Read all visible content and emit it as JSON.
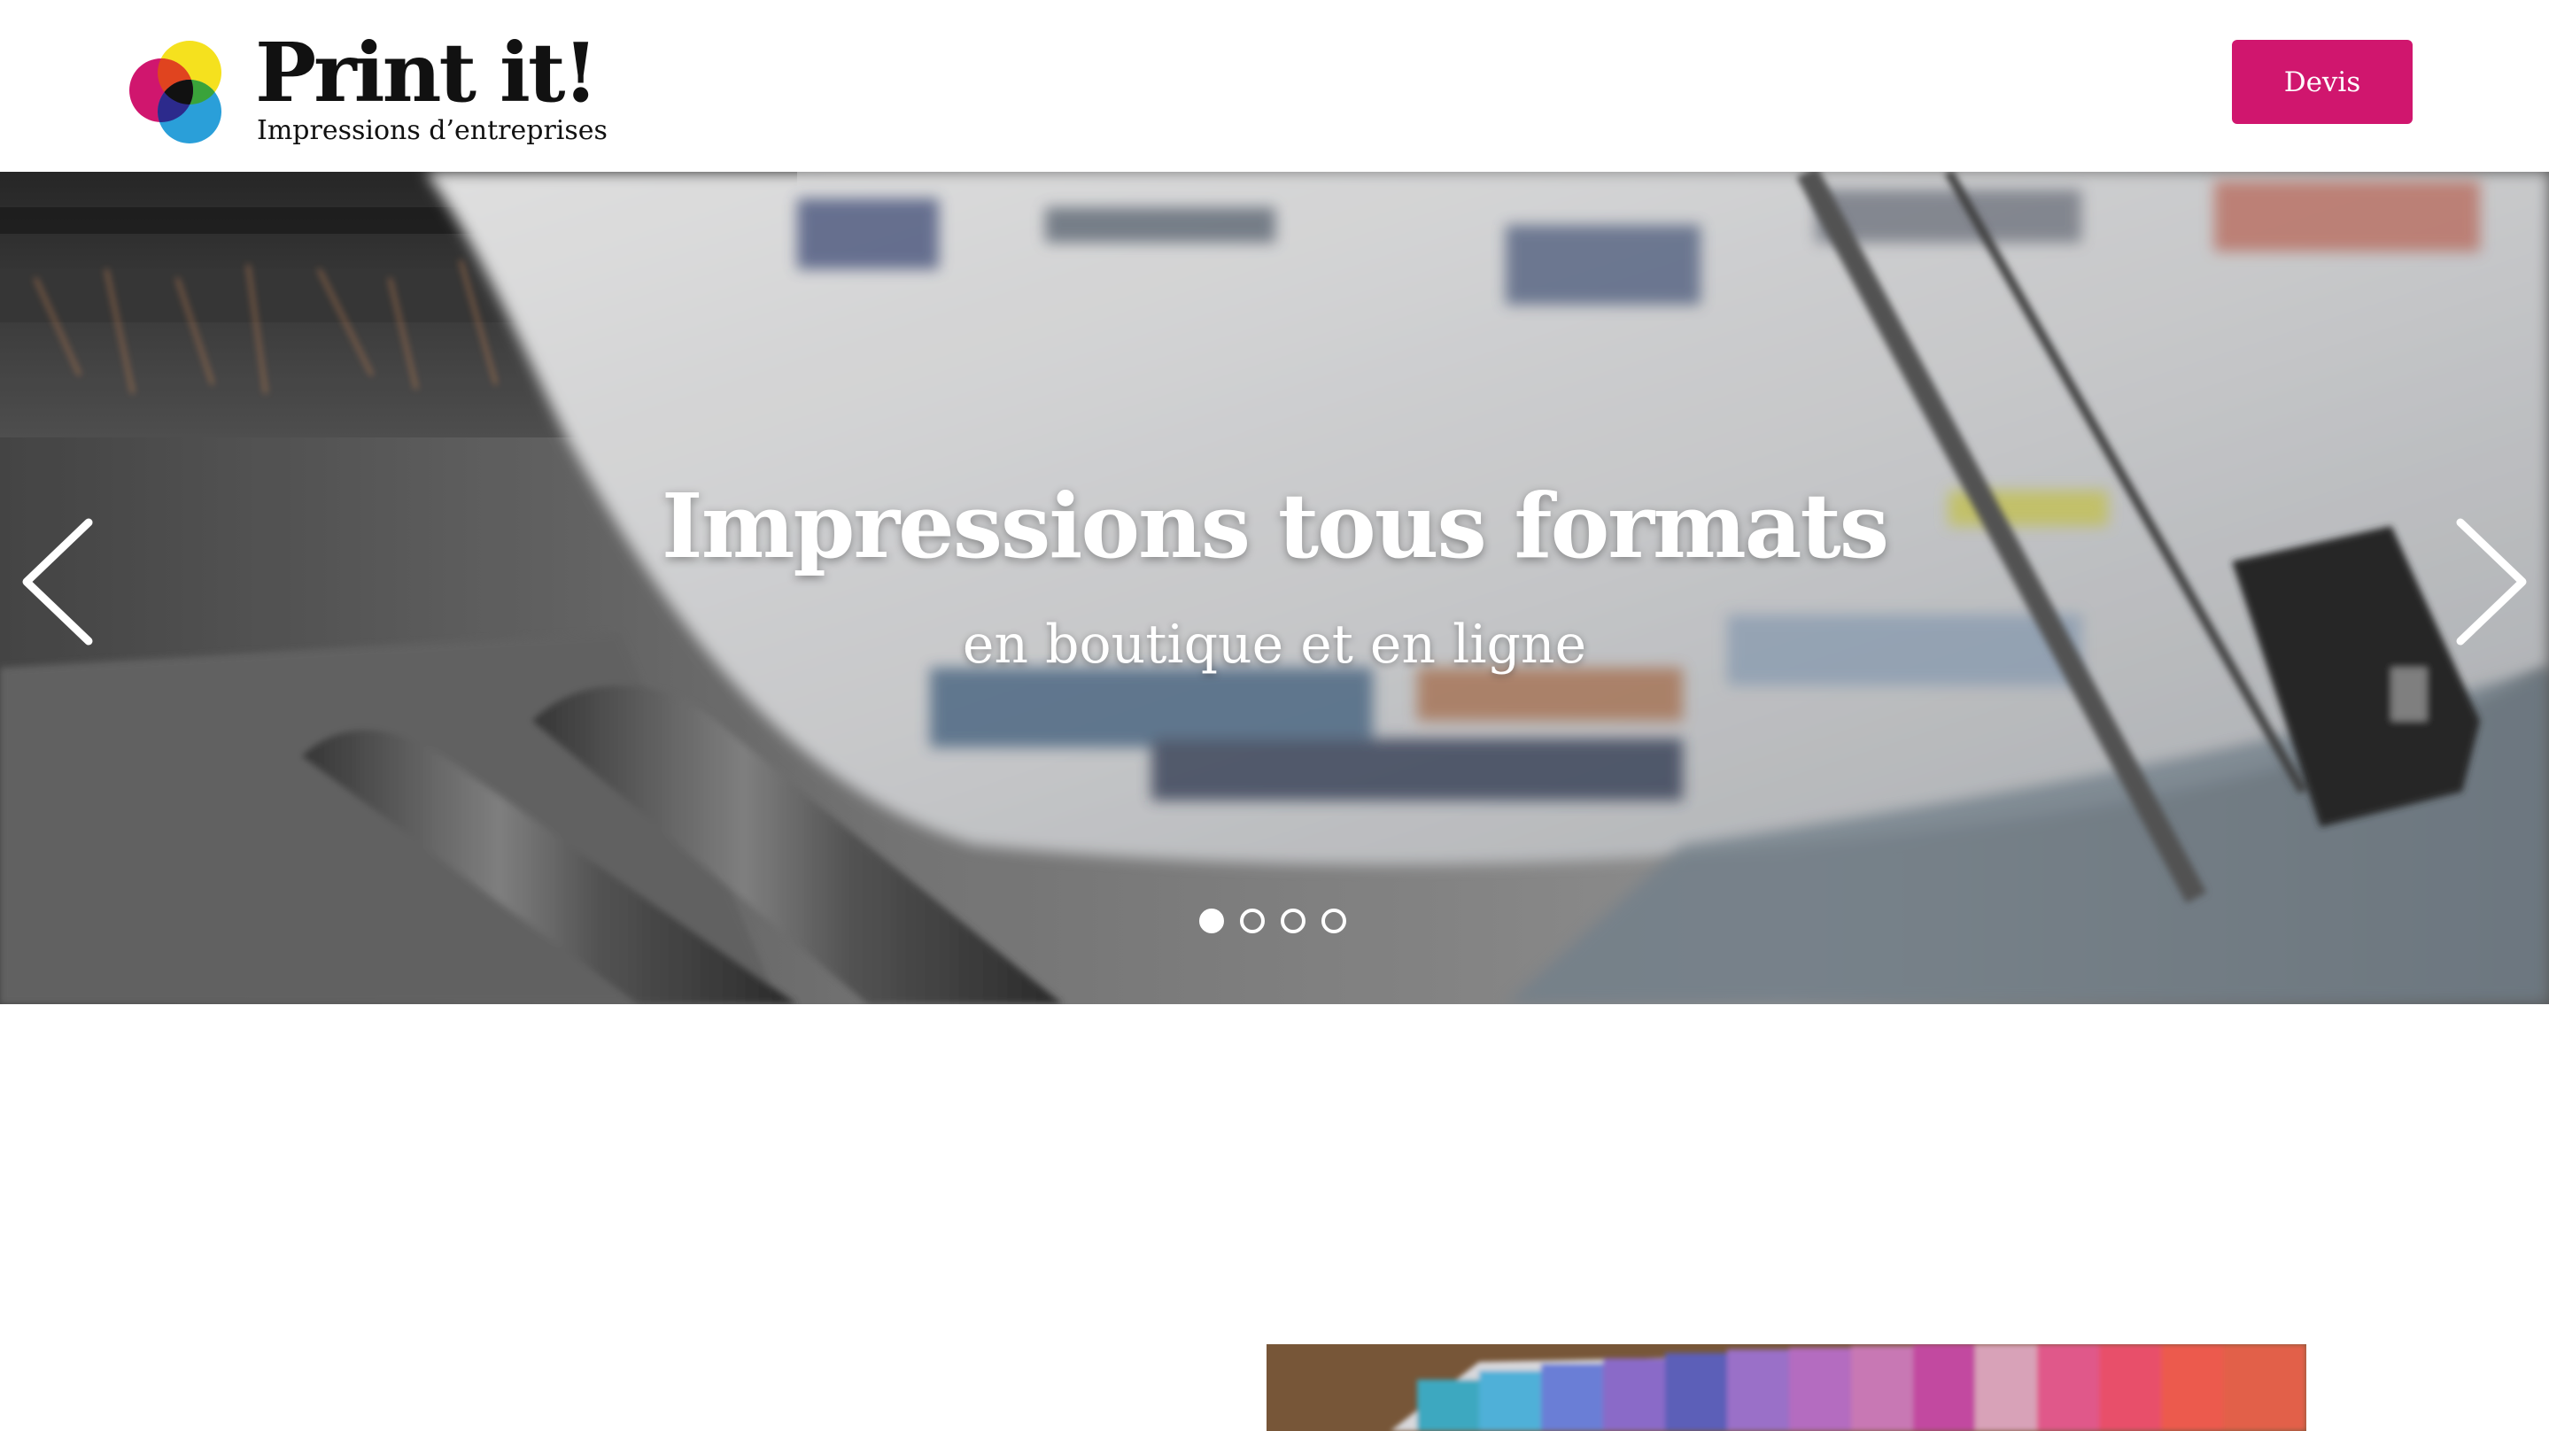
{
  "header": {
    "logo_title": "Print it!",
    "logo_subtitle": "Impressions d’entreprises",
    "cta_label": "Devis"
  },
  "hero": {
    "title": "Impressions tous formats",
    "subtitle": "en boutique et en ligne",
    "slides_total": 4,
    "active_slide": 1
  },
  "section": {
    "heading": ""
  },
  "icons": {
    "logo": "cmy-circles-logo-icon",
    "prev": "chevron-left-icon",
    "next": "chevron-right-icon"
  },
  "colors": {
    "accent": "#d0166e",
    "logo_magenta": "#d0166e",
    "logo_yellow": "#f5e11e",
    "logo_cyan": "#2a9fd9",
    "logo_green": "#3aa33a"
  }
}
